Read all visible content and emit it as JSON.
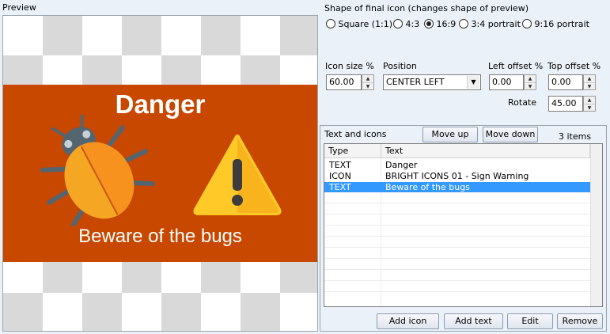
{
  "preview": {
    "label": "Preview",
    "title": "Danger",
    "subtitle": "Beware of the bugs",
    "banner_color": "#c84800",
    "icons": [
      "bug-icon",
      "warning-triangle-icon"
    ]
  },
  "shape": {
    "label": "Shape of final icon (changes shape of preview)",
    "options": [
      "Square (1:1)",
      "4:3",
      "16:9",
      "3:4 portrait",
      "9:16 portrait"
    ],
    "selected": "16:9"
  },
  "settings": {
    "icon_size_label": "Icon size %",
    "icon_size_value": "60.00",
    "position_label": "Position",
    "position_value": "CENTER LEFT",
    "left_offset_label": "Left offset %",
    "left_offset_value": "0.00",
    "top_offset_label": "Top offset %",
    "top_offset_value": "0.00",
    "rotate_label": "Rotate",
    "rotate_value": "45.00"
  },
  "text_icons": {
    "label": "Text and icons",
    "move_up": "Move up",
    "move_down": "Move down",
    "count": "3 items",
    "columns": [
      "Type",
      "Text"
    ],
    "rows": [
      {
        "type": "TEXT",
        "text": "Danger"
      },
      {
        "type": "ICON",
        "text": "BRIGHT ICONS 01 - Sign Warning"
      },
      {
        "type": "TEXT",
        "text": "Beware of the bugs"
      }
    ],
    "selected_row": 2,
    "buttons": {
      "add_icon": "Add icon",
      "add_text": "Add text",
      "edit": "Edit",
      "remove": "Remove"
    }
  }
}
